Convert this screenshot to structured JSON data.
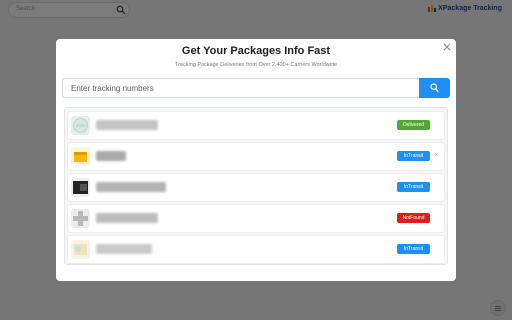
{
  "background": {
    "search_placeholder": "Search",
    "brand_name": "XPackage Tracking"
  },
  "modal": {
    "title": "Get Your Packages Info Fast",
    "subtitle": "Tracking Package Deliveries from Over 2,400+ Carriers Worldwide",
    "input_placeholder": "Enter tracking numbers"
  },
  "packages": [
    {
      "status": "Delivered",
      "status_color": "#52a82e"
    },
    {
      "status": "InTransit",
      "status_color": "#1e90f5",
      "remove_label": "x"
    },
    {
      "status": "InTransit",
      "status_color": "#1e90f5"
    },
    {
      "status": "NotFound",
      "status_color": "#e21b1b"
    },
    {
      "status": "InTransit",
      "status_color": "#1e90f5"
    }
  ],
  "icons": [
    "search-icon",
    "close-icon",
    "menu-icon",
    "brand-logo-icon"
  ]
}
